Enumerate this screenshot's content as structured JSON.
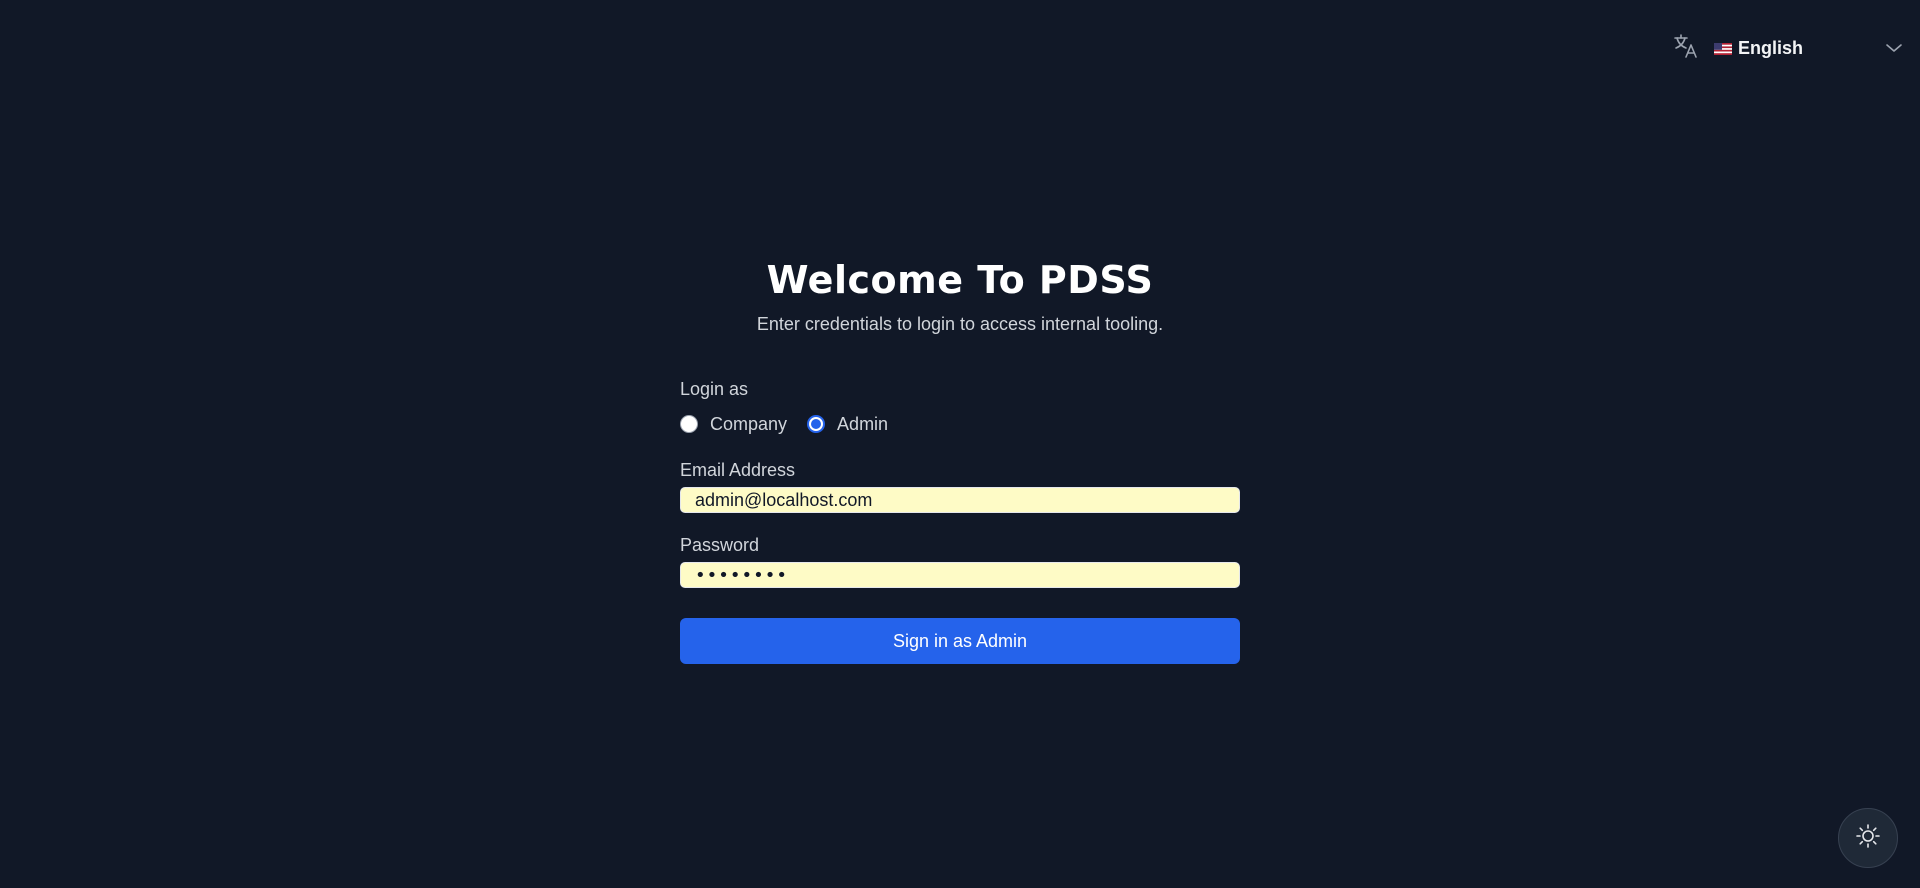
{
  "header": {
    "language": {
      "icon": "translate-icon",
      "flag": "us-flag-icon",
      "label": "English",
      "chevron": "chevron-down-icon"
    }
  },
  "main": {
    "title": "Welcome To PDSS",
    "subtitle": "Enter credentials to login to access internal tooling.",
    "login_as": {
      "label": "Login as",
      "options": [
        {
          "label": "Company",
          "selected": false
        },
        {
          "label": "Admin",
          "selected": true
        }
      ]
    },
    "email": {
      "label": "Email Address",
      "value": "admin@localhost.com"
    },
    "password": {
      "label": "Password",
      "value": "••••••••"
    },
    "submit_label": "Sign in as Admin"
  },
  "theme_toggle": {
    "icon": "sun-icon"
  },
  "colors": {
    "background": "#111827",
    "primary": "#2563eb",
    "input_autofill": "#fefbc6"
  }
}
